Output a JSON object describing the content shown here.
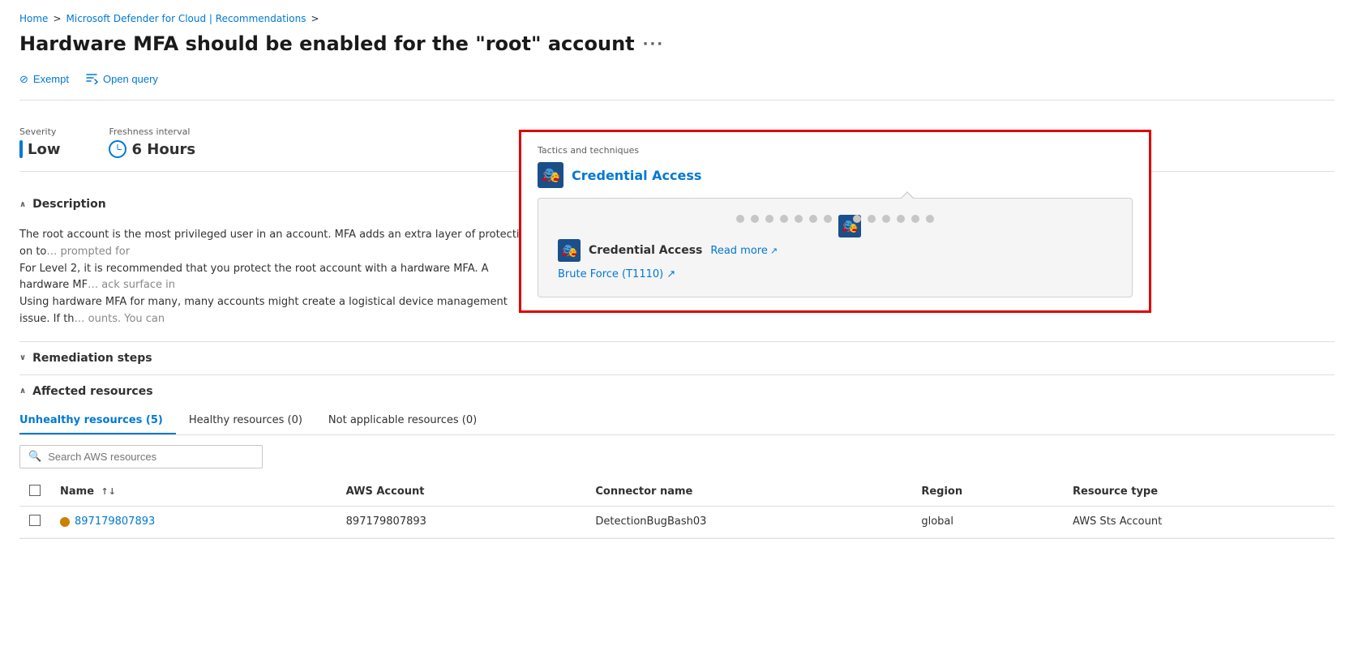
{
  "breadcrumb": {
    "home": "Home",
    "separator1": ">",
    "middle": "Microsoft Defender for Cloud | Recommendations",
    "separator2": ">"
  },
  "page": {
    "title": "Hardware MFA should be enabled for the \"root\" account",
    "ellipsis": "···"
  },
  "actions": {
    "exempt_label": "Exempt",
    "open_query_label": "Open query"
  },
  "info": {
    "severity_label": "Severity",
    "severity_value": "Low",
    "freshness_label": "Freshness interval",
    "freshness_value": "6 Hours"
  },
  "tactics": {
    "section_label": "Tactics and techniques",
    "tactic_name": "Credential Access",
    "tooltip": {
      "tactic_name": "Credential Access",
      "read_more": "Read more",
      "technique_label": "Brute Force",
      "technique_code": "(T1110)"
    }
  },
  "description": {
    "header": "Description",
    "text": "The root account is the most privileged user in an account. MFA adds an extra layer of protection on to  prompted for\nFor Level 2, it is recommended that you protect the root account with a hardware MFA. A hardware MF  ack surface in\nUsing hardware MFA for many, many accounts might create a logistical device management issue. If th  ounts. You can"
  },
  "remediation": {
    "header": "Remediation steps"
  },
  "affected": {
    "header": "Affected resources",
    "tabs": [
      {
        "label": "Unhealthy resources (5)",
        "active": true
      },
      {
        "label": "Healthy resources (0)",
        "active": false
      },
      {
        "label": "Not applicable resources (0)",
        "active": false
      }
    ],
    "search_placeholder": "Search AWS resources",
    "table": {
      "columns": [
        {
          "key": "name",
          "label": "Name",
          "sortable": true
        },
        {
          "key": "aws_account",
          "label": "AWS Account",
          "sortable": false
        },
        {
          "key": "connector_name",
          "label": "Connector name",
          "sortable": false
        },
        {
          "key": "region",
          "label": "Region",
          "sortable": false
        },
        {
          "key": "resource_type",
          "label": "Resource type",
          "sortable": false
        }
      ],
      "rows": [
        {
          "name": "897179807893",
          "aws_account": "897179807893",
          "connector_name": "DetectionBugBash03",
          "region": "global",
          "resource_type": "AWS Sts Account"
        }
      ]
    }
  },
  "icons": {
    "search": "🔍",
    "exempt": "⊘",
    "open_query": "🔽",
    "chevron_down": "∧",
    "chevron_up": "∨",
    "external_link": "↗"
  },
  "colors": {
    "accent": "#0078d4",
    "border_red": "#e00000",
    "severity_low": "#0078d4"
  }
}
